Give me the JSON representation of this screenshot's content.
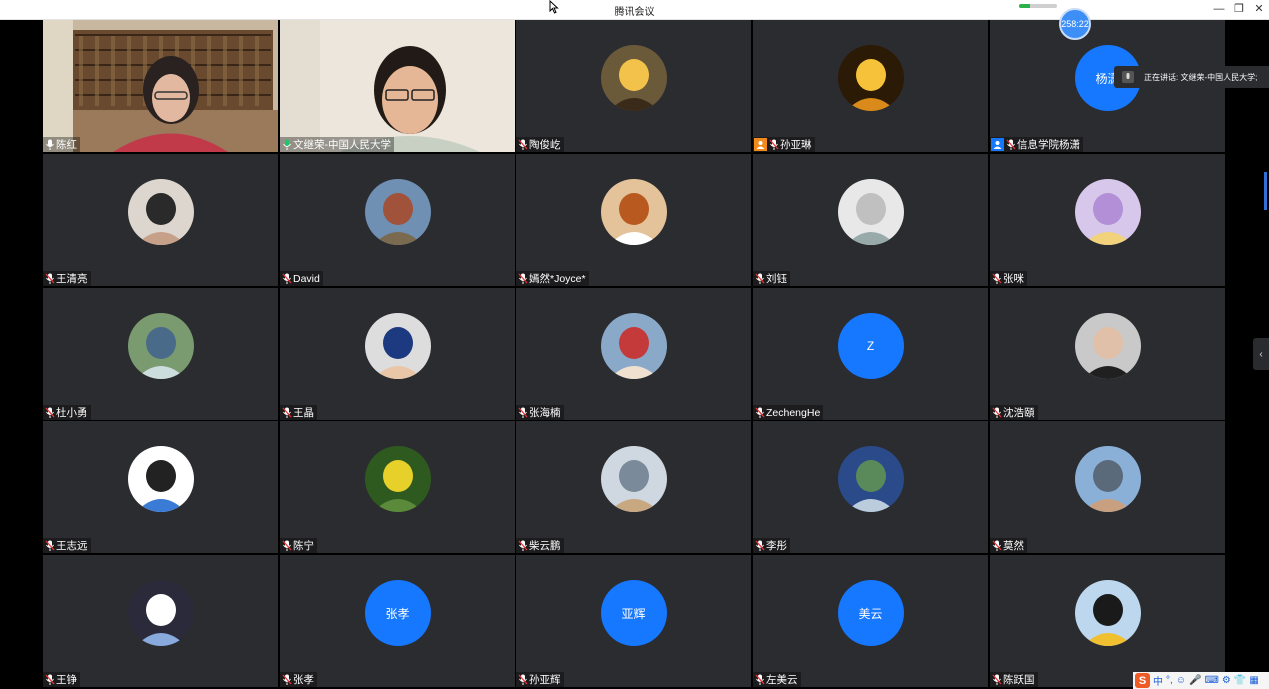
{
  "window": {
    "title": "腾讯会议",
    "minimize_glyph": "—",
    "restore_glyph": "❐",
    "close_glyph": "✕"
  },
  "network_indicator": {
    "level": 0.3
  },
  "timer": {
    "value": "258:22"
  },
  "speaking_banner": {
    "text": "正在讲话: 文继荣-中国人民大学;"
  },
  "colors": {
    "accent": "#1677ff",
    "tile_bg": "#2b2c30",
    "speaking_border": "#21c36b"
  },
  "participants": [
    {
      "name": "陈红",
      "kind": "video",
      "icon": "mic-icon"
    },
    {
      "name": "文继荣-中国人民大学",
      "kind": "video",
      "speaking": true,
      "icon": "mic-active-icon"
    },
    {
      "name": "陶俊屹",
      "kind": "photo",
      "icon": "mic-muted-icon"
    },
    {
      "name": "孙亚琳",
      "kind": "photo",
      "host": true,
      "icon": "mic-muted-icon"
    },
    {
      "name": "信息学院杨潇",
      "kind": "text",
      "avatar_text": "杨潇",
      "cohost": true,
      "icon": "mic-muted-icon"
    },
    {
      "name": "王清亮",
      "kind": "photo",
      "icon": "mic-muted-icon"
    },
    {
      "name": "David",
      "kind": "photo",
      "icon": "mic-muted-icon"
    },
    {
      "name": "嫣然*Joyce*",
      "kind": "photo",
      "icon": "mic-muted-icon"
    },
    {
      "name": "刘钰",
      "kind": "photo",
      "icon": "mic-muted-icon"
    },
    {
      "name": "张咪",
      "kind": "photo",
      "icon": "mic-muted-icon"
    },
    {
      "name": "杜小勇",
      "kind": "photo",
      "icon": "mic-muted-icon"
    },
    {
      "name": "王晶",
      "kind": "photo",
      "icon": "mic-muted-icon"
    },
    {
      "name": "张海楠",
      "kind": "photo",
      "icon": "mic-muted-icon"
    },
    {
      "name": "ZechengHe",
      "kind": "text",
      "avatar_text": "Z",
      "icon": "mic-muted-icon"
    },
    {
      "name": "沈浩頤",
      "kind": "photo",
      "icon": "mic-muted-icon"
    },
    {
      "name": "王志远",
      "kind": "photo",
      "icon": "mic-muted-icon"
    },
    {
      "name": "陈宁",
      "kind": "photo",
      "icon": "mic-muted-icon"
    },
    {
      "name": "柴云鹏",
      "kind": "photo",
      "icon": "mic-muted-icon"
    },
    {
      "name": "李彤",
      "kind": "photo",
      "icon": "mic-muted-icon"
    },
    {
      "name": "莫然",
      "kind": "photo",
      "icon": "mic-muted-icon"
    },
    {
      "name": "王铮",
      "kind": "photo",
      "icon": "mic-muted-icon"
    },
    {
      "name": "张孝",
      "kind": "text",
      "avatar_text": "张孝",
      "icon": "mic-muted-icon"
    },
    {
      "name": "孙亚辉",
      "kind": "text",
      "avatar_text": "亚辉",
      "icon": "mic-muted-icon"
    },
    {
      "name": "左美云",
      "kind": "text",
      "avatar_text": "美云",
      "icon": "mic-muted-icon"
    },
    {
      "name": "陈跃国",
      "kind": "photo",
      "icon": "mic-muted-icon"
    }
  ],
  "ime": {
    "logo": "S",
    "mode": "中",
    "punct": "°,"
  }
}
